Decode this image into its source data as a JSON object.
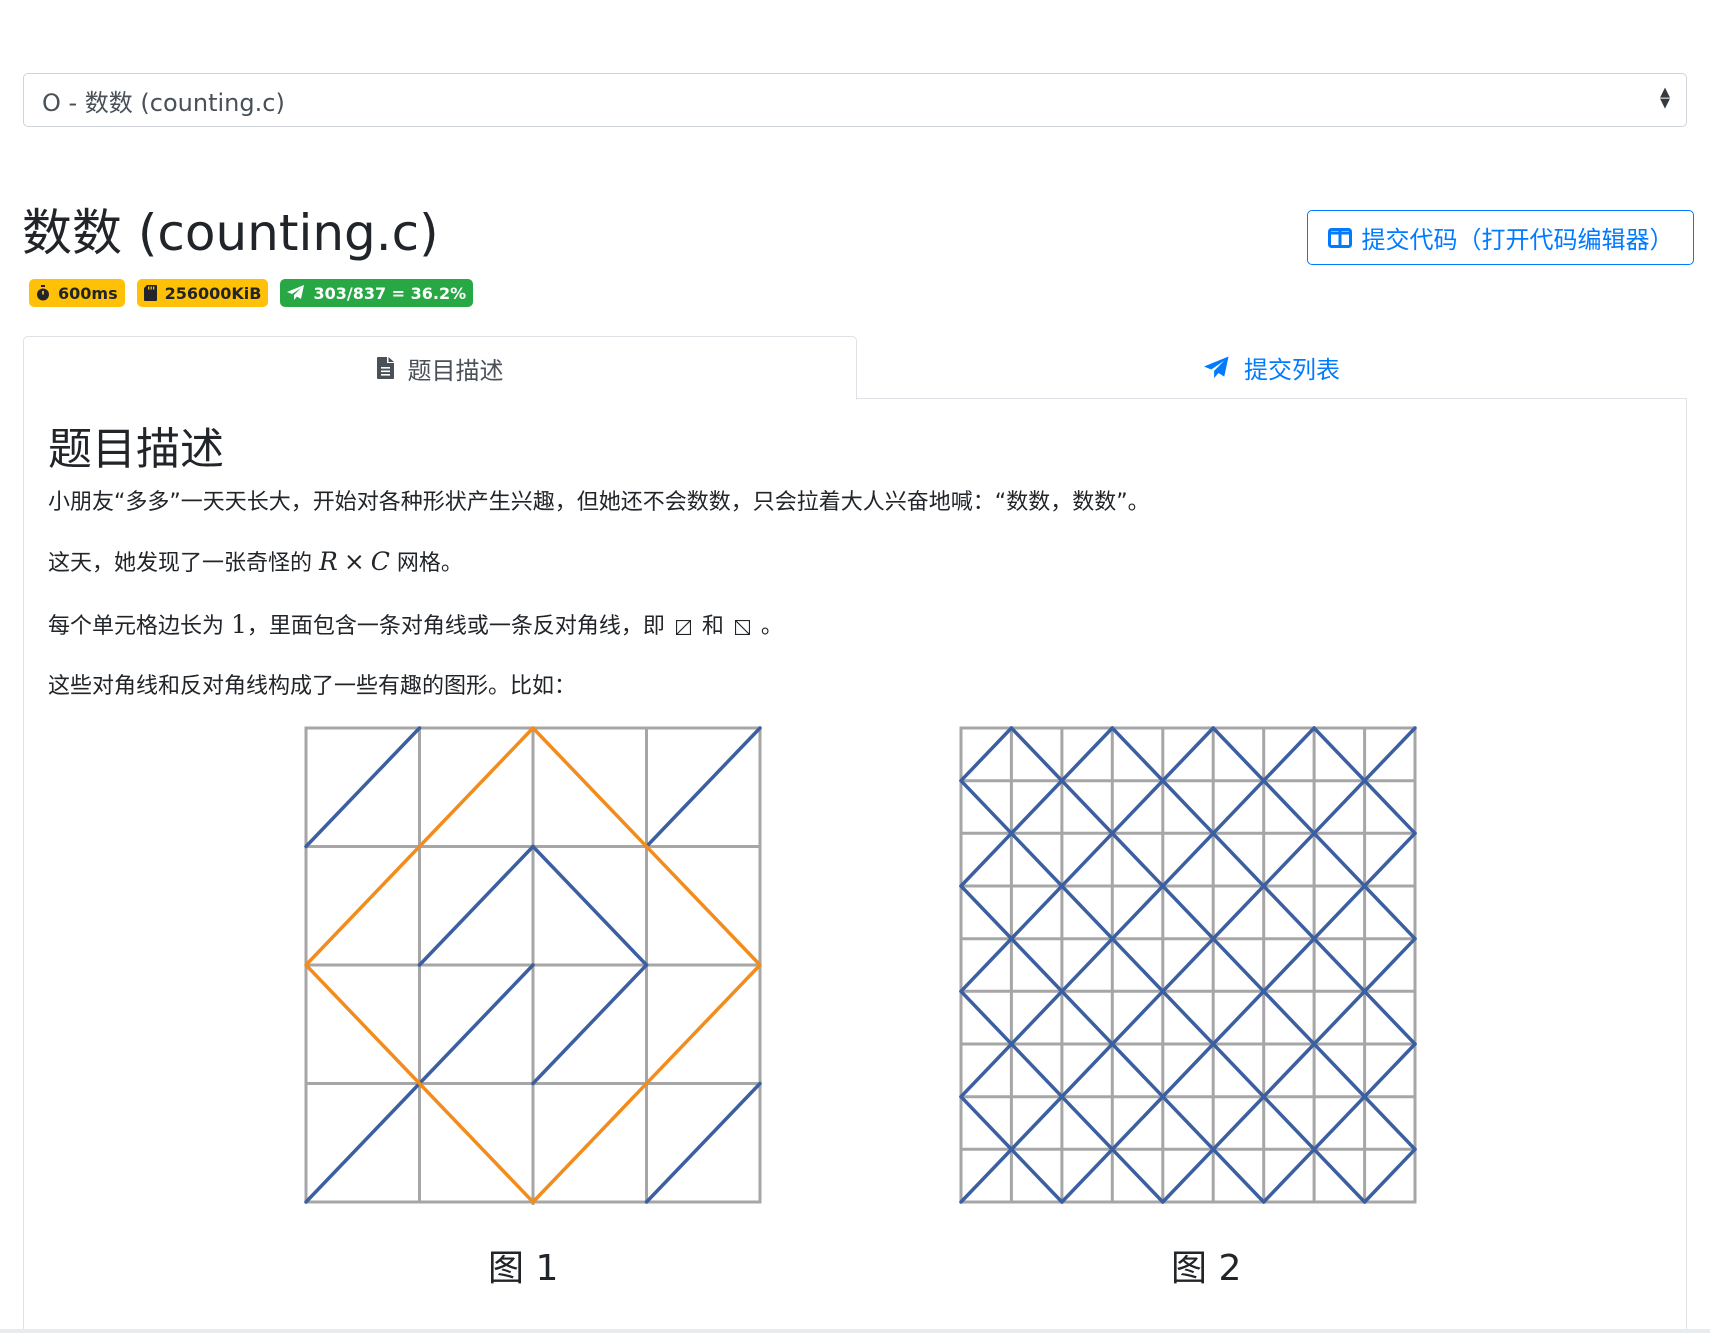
{
  "problem_select": {
    "value": "O - 数数 (counting.c)"
  },
  "title": "数数 (counting.c)",
  "submit_button": {
    "label": "提交代码（打开代码编辑器）",
    "icon": "columns-icon"
  },
  "badges": [
    {
      "label": "600ms",
      "icon": "stopwatch-icon",
      "color": "#ffc107"
    },
    {
      "label": "256000KiB",
      "icon": "sd-card-icon",
      "color": "#ffc107"
    },
    {
      "label": "303/837 = 36.2%",
      "icon": "paper-plane-icon",
      "color": "#28a745"
    }
  ],
  "tabs": [
    {
      "label": "题目描述",
      "icon": "file-icon",
      "active": true
    },
    {
      "label": "提交列表",
      "icon": "paper-plane-icon",
      "active": false
    }
  ],
  "content": {
    "heading": "题目描述",
    "p1": "小朋友“多多”一天天长大，开始对各种形状产生兴趣，但她还不会数数，只会拉着大人兴奋地喊：“数数，数数”。",
    "p2": {
      "before": "这天，她发现了一张奇怪的 ",
      "math_r": "R",
      "times": "×",
      "math_c": "C",
      "after": " 网格。"
    },
    "p3": {
      "before": "每个单元格边长为 ",
      "num": "1",
      "mid": "，里面包含一条对角线或一条反对角线，即 ",
      "and": " 和 ",
      "end": " 。"
    },
    "p4": "这些对角线和反对角线构成了一些有趣的图形。比如：",
    "figures": [
      {
        "caption": "图 1"
      },
      {
        "caption": "图 2"
      }
    ]
  },
  "colors": {
    "primary": "#007bff",
    "grid_gray": "#a6a6a6",
    "line_blue": "#3b5fa0",
    "line_orange": "#f28c1c"
  }
}
